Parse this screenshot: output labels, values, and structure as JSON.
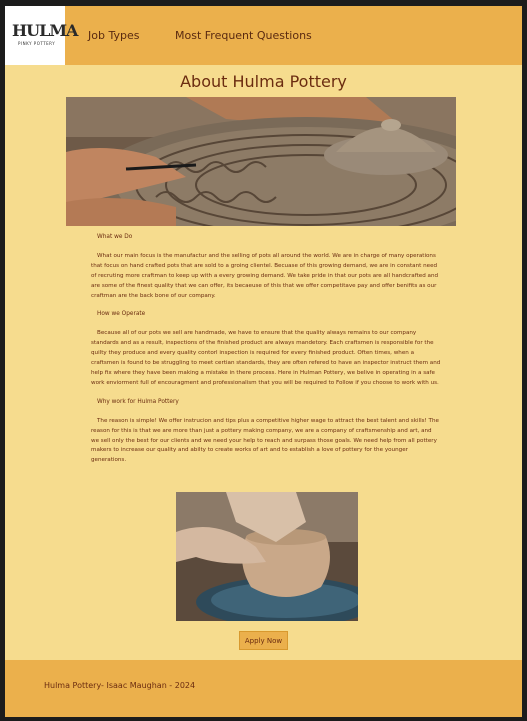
{
  "header": {
    "logo_text": "HULMA",
    "logo_subtext": "PINKY POTTERY",
    "nav": [
      "Job Types",
      "Most Frequent Questions"
    ]
  },
  "main": {
    "title": "About Hulma Pottery",
    "sections": [
      {
        "heading": "What we Do",
        "body": "What our main focus is the manufactur and the selling of pots all around the world. We are in charge of many operations that focus on hand crafted pots that are sold to a groing clientel. Becuase of this growing demand, we are in constant need of recruting more craftman to keep up with a every growing demand. We take pride in that our pots are all handcrafted and are some of the finest quality that we can offer, its becaeuse of this that we offer competitave pay and offer benifits as our craftman are the back bone of our company."
      },
      {
        "heading": "How we Operate",
        "body": "Because all of our pots we sell are handmade, we have to ensure that the quality always remains to our company standards and as a result, inspections of the finished product are always mandetory. Each craftsmen is responsible for the quilty they produce and every quality contorl inspection is required for every finished product. Often times, when a craftsmen is found to be struggling to meet certian standards, they are often refered to have an inspector instruct them and help fix where they have been making a mistake in there process. Here in Hulman Pottery, we belive in operating in a safe work enviorment full of encouragment and professionalism that you will be required to Follow if you choose to work with us."
      },
      {
        "heading": "Why work for Hulma Pottery",
        "body": "The reason is simple! We offer instrucion and tips plus a competitive higher wage to attract the best talent and skills! The reason for this is that we are more than just a pottery making company, we are a company of craftsmenship and art, and we sell only the best for our clients and we need your help to reach and surpass those goals. We need help from all pottery makers to increase our quality and abilty to create works of art and to establish a love of pottery for the younger generations."
      }
    ],
    "apply_label": "Apply Now"
  },
  "footer": {
    "text": "Hulma Pottery- Isaac Maughan - 2024"
  },
  "colors": {
    "header_bg": "#ebb04c",
    "page_bg": "#f6dc8e",
    "text": "#6b2c10"
  }
}
